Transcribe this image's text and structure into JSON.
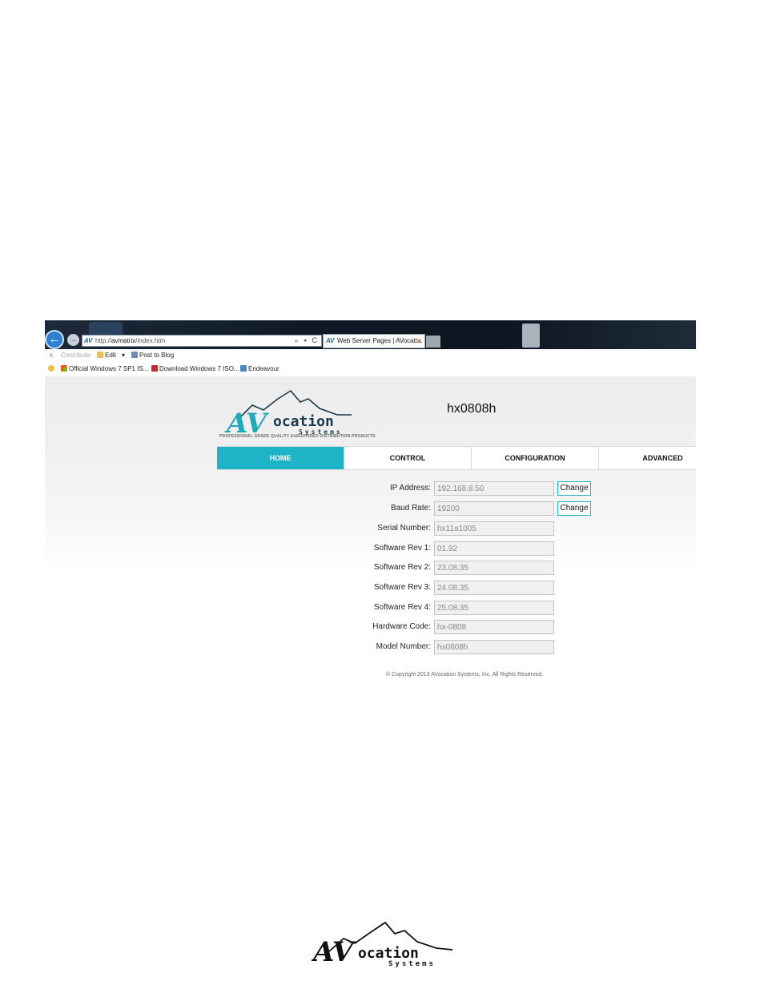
{
  "browser": {
    "address_av": "AV",
    "address_url_prefix": "http://",
    "address_url_host": "avmatrix",
    "address_url_path": "/index.htm",
    "address_tools": "⌕ ▾ C",
    "tab_av": "AV",
    "tab_title": "Web Server Pages | AVocati...",
    "tab_close": "✕",
    "back_icon": "←",
    "forward_icon": "→",
    "cmdbar": {
      "x": "x",
      "contribute": "Contribute",
      "edit": "Edit",
      "edit_arrow": "▾",
      "post": "Post to Blog"
    },
    "favorites": [
      "Official Windows 7 SP1 IS...",
      "Download Windows 7 ISO...",
      "Endeavour"
    ]
  },
  "brand": {
    "logo_big": "AV",
    "logo_word": "ocation",
    "logo_sub": "Systems",
    "tagline": "PROFESSIONAL GRADE QUALITY AUDIO/VIDEO DISTRIBUTION PRODUCTS"
  },
  "device_name": "hx0808h",
  "nav": {
    "tabs": [
      {
        "label": "HOME",
        "active": true
      },
      {
        "label": "CONTROL",
        "active": false
      },
      {
        "label": "CONFIGURATION",
        "active": false
      },
      {
        "label": "ADVANCED",
        "active": false
      }
    ]
  },
  "info": {
    "change_label": "Change",
    "rows": [
      {
        "label": "IP Address:",
        "value": "192.168.8.50"
      },
      {
        "label": "Baud Rate:",
        "value": "19200"
      },
      {
        "label": "Serial Number:",
        "value": "hx11a1005"
      },
      {
        "label": "Software Rev 1:",
        "value": "01.92"
      },
      {
        "label": "Software Rev 2:",
        "value": "23.08.35"
      },
      {
        "label": "Software Rev 3:",
        "value": "24.08.35"
      },
      {
        "label": "Software Rev 4:",
        "value": "25.08.35"
      },
      {
        "label": "Hardware Code:",
        "value": "hx-0808"
      },
      {
        "label": "Model Number:",
        "value": "hx0808h"
      }
    ]
  },
  "copyright": "© Copyright 2013 AVocation Systems, Inc. All Rights Reserved.",
  "colors": {
    "accent": "#1fb3c8",
    "logo_dark": "#1a3a4a",
    "logo_teal": "#1fa9bd"
  }
}
